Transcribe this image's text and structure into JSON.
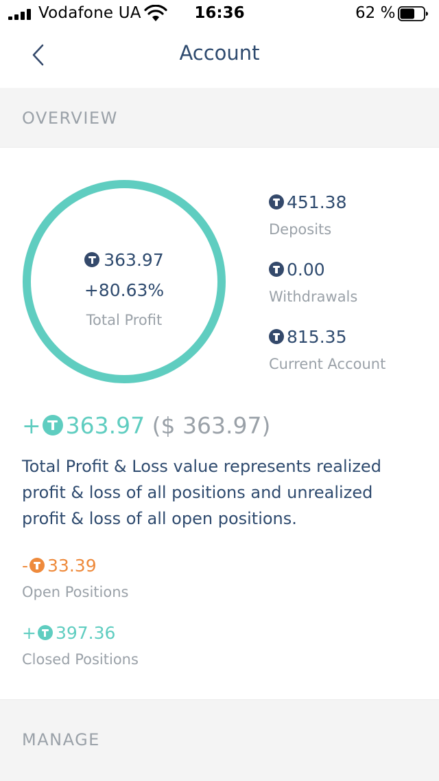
{
  "status_bar": {
    "carrier": "Vodafone UA",
    "time": "16:36",
    "battery_percent": "62 %",
    "battery_level": 0.62
  },
  "nav": {
    "title": "Account"
  },
  "sections": {
    "overview": "OVERVIEW",
    "manage": "MANAGE"
  },
  "overview": {
    "ring": {
      "value": "363.97",
      "percent": "+80.63%",
      "caption": "Total Profit"
    },
    "stats": [
      {
        "value": "451.38",
        "label": "Deposits"
      },
      {
        "value": "0.00",
        "label": "Withdrawals"
      },
      {
        "value": "815.35",
        "label": "Current Account"
      }
    ],
    "total": {
      "sign": "+",
      "value": "363.97",
      "usd": "($ 363.97)"
    },
    "description": "Total Profit & Loss value represents realized profit & loss of all positions and unrealized profit & loss of all open positions.",
    "positions": [
      {
        "sign": "-",
        "value": "33.39",
        "label": "Open Positions"
      },
      {
        "sign": "+",
        "value": "397.36",
        "label": "Closed Positions"
      }
    ]
  },
  "icons": {
    "coin": "tether-coin-icon",
    "back": "chevron-left-icon"
  },
  "colors": {
    "navy": "#2e4a6e",
    "teal": "#5fcdc0",
    "orange": "#ee8a3c",
    "gray": "#9aa1a8",
    "section_bg": "#f4f4f4"
  }
}
